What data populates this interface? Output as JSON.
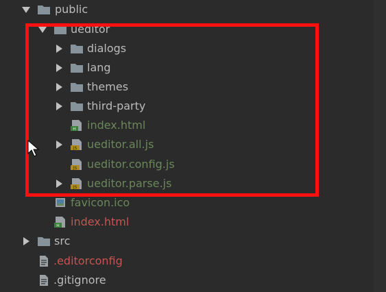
{
  "tree": {
    "rows": [
      {
        "label": "public",
        "kind": "folder",
        "expanded": true,
        "color": "gray"
      },
      {
        "label": "ueditor",
        "kind": "folder",
        "expanded": true,
        "color": "gray"
      },
      {
        "label": "dialogs",
        "kind": "folder",
        "expanded": false,
        "color": "gray"
      },
      {
        "label": "lang",
        "kind": "folder",
        "expanded": false,
        "color": "gray"
      },
      {
        "label": "themes",
        "kind": "folder",
        "expanded": false,
        "color": "gray"
      },
      {
        "label": "third-party",
        "kind": "folder",
        "expanded": false,
        "color": "gray"
      },
      {
        "label": "index.html",
        "kind": "html-file",
        "color": "green"
      },
      {
        "label": "ueditor.all.js",
        "kind": "js-file",
        "expandable": true,
        "color": "green"
      },
      {
        "label": "ueditor.config.js",
        "kind": "js-file",
        "color": "green"
      },
      {
        "label": "ueditor.parse.js",
        "kind": "js-file",
        "expandable": true,
        "color": "green"
      },
      {
        "label": "favicon.ico",
        "kind": "image-file",
        "color": "green"
      },
      {
        "label": "index.html",
        "kind": "html-file",
        "color": "red"
      },
      {
        "label": "src",
        "kind": "folder",
        "expanded": false,
        "color": "gray"
      },
      {
        "label": ".editorconfig",
        "kind": "text-file",
        "color": "red"
      },
      {
        "label": ".gitignore",
        "kind": "text-file",
        "color": "gray"
      }
    ]
  },
  "colors": {
    "background": "#2b2b2b",
    "text_default": "#bbbbbb",
    "text_green": "#6a8759",
    "text_red": "#c75450",
    "highlight_border": "#ff1010",
    "folder_icon": "#87939a",
    "js_badge": "#b08b1f",
    "html_badge": "#3c7f3c"
  }
}
